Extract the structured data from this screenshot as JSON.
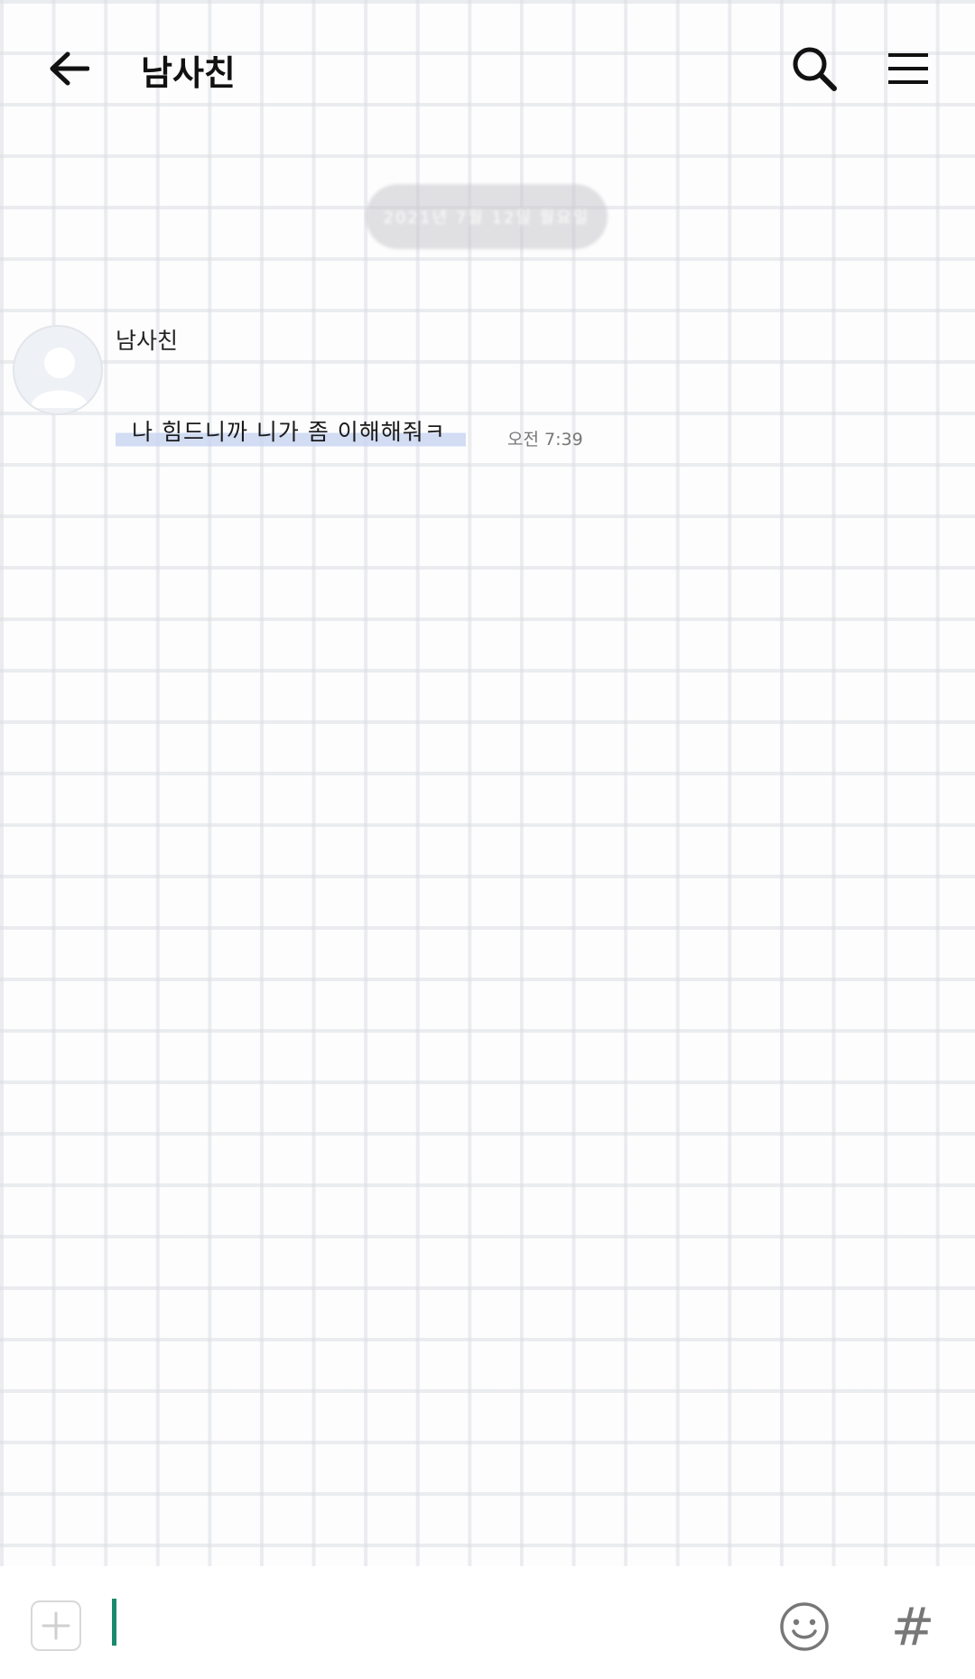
{
  "header": {
    "title": "남사친",
    "back_icon": "arrow-left-icon",
    "search_icon": "search-icon",
    "menu_icon": "hamburger-menu-icon"
  },
  "date_divider": {
    "label": "2021년 7월 12일 월요일"
  },
  "messages": [
    {
      "sender": "남사친",
      "text": "나 힘드니까 니가 좀 이해해줘ㅋ",
      "time": "오전 7:39",
      "avatar_icon": "default-avatar-icon"
    }
  ],
  "input_bar": {
    "value": "",
    "plus_icon": "plus-icon",
    "emoji_icon": "smiley-icon",
    "hash_label": "#",
    "caret_color": "#1a8a6c"
  }
}
